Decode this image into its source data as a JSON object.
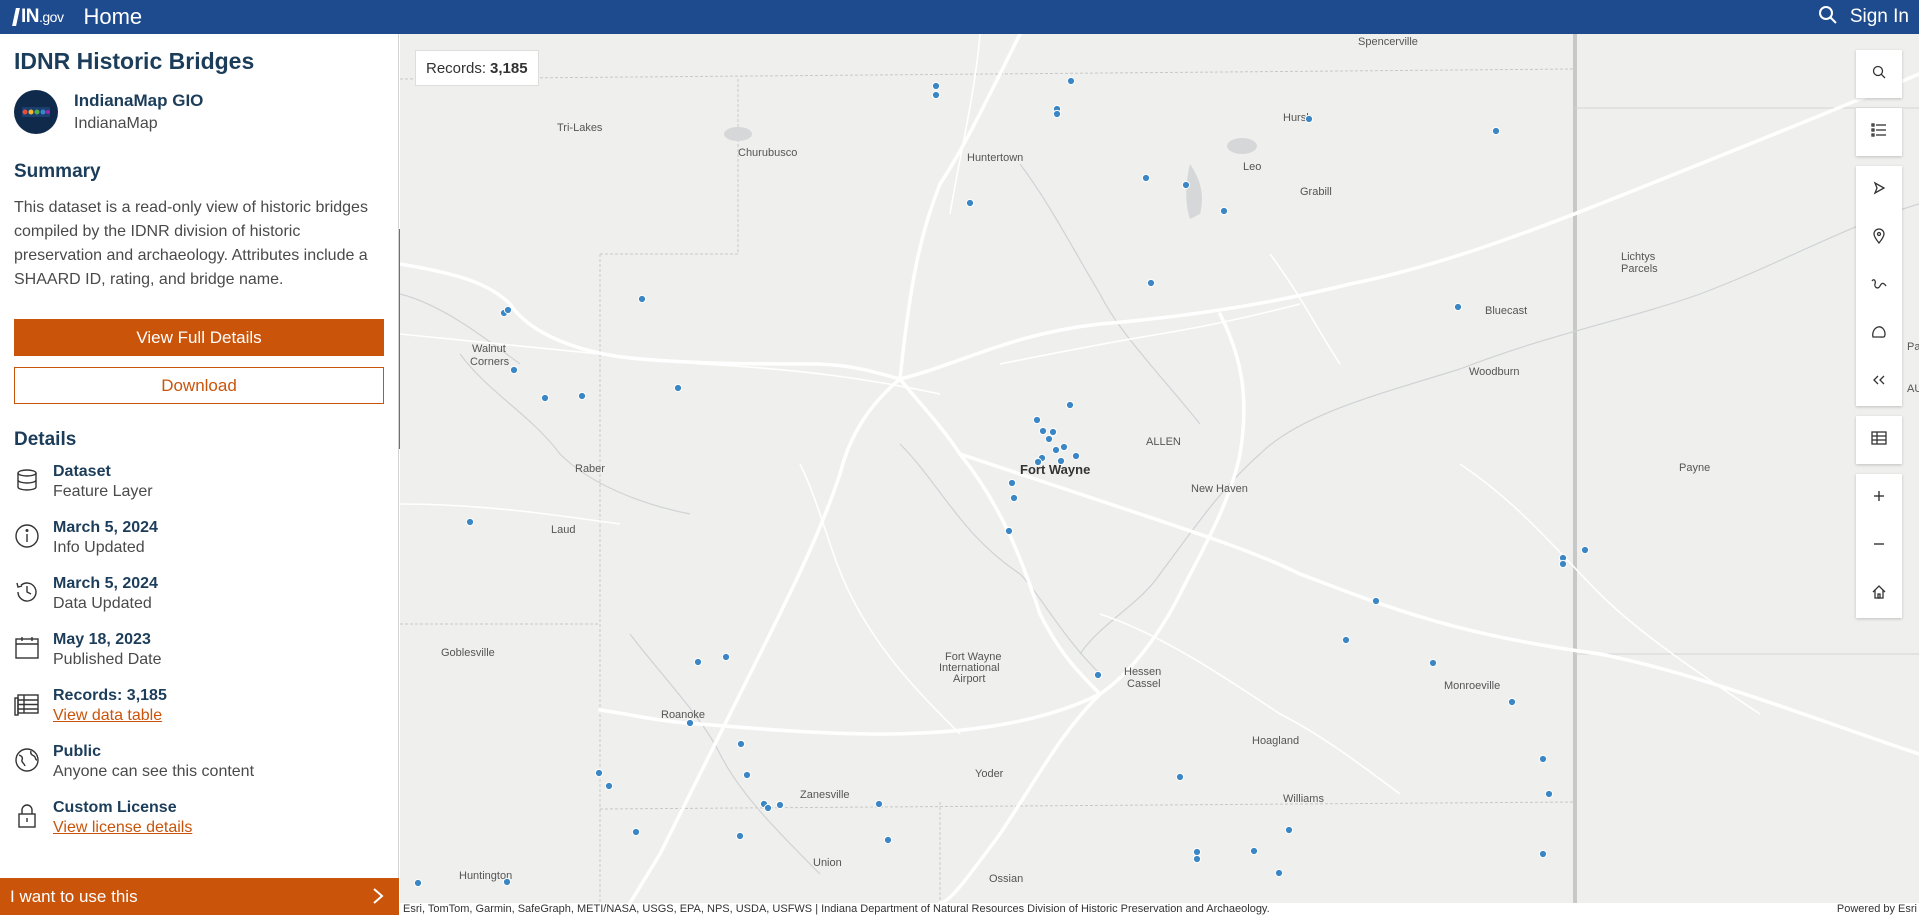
{
  "topbar": {
    "logo_text": "IN",
    "logo_suffix": ".gov",
    "home_label": "Home",
    "sign_in_label": "Sign In",
    "search_icon": "search-icon"
  },
  "item": {
    "title": "IDNR Historic Bridges",
    "owner_name": "IndianaMap GIO",
    "owner_org": "IndianaMap"
  },
  "summary": {
    "heading": "Summary",
    "text": "This dataset is a read-only view of historic bridges compiled by the IDNR division of historic preservation and archaeology. Attributes include a SHAARD ID, rating, and bridge name."
  },
  "buttons": {
    "view_full_details": "View Full Details",
    "download": "Download"
  },
  "details": {
    "heading": "Details",
    "rows": [
      {
        "icon": "database-icon",
        "main": "Dataset",
        "sub": "Feature Layer"
      },
      {
        "icon": "info-icon",
        "main": "March 5, 2024",
        "sub": "Info Updated"
      },
      {
        "icon": "history-icon",
        "main": "March 5, 2024",
        "sub": "Data Updated"
      },
      {
        "icon": "calendar-icon",
        "main": "May 18, 2023",
        "sub": "Published Date"
      },
      {
        "icon": "table-icon",
        "main": "Records: 3,185",
        "link": "View data table"
      },
      {
        "icon": "globe-icon",
        "main": "Public",
        "sub": "Anyone can see this content"
      },
      {
        "icon": "lock-icon",
        "main": "Custom License",
        "link": "View license details"
      }
    ]
  },
  "use_bar": {
    "label": "I want to use this"
  },
  "map": {
    "records_label": "Records:",
    "records_value": "3,185",
    "attribution": "Esri, TomTom, Garmin, SafeGraph, METI/NASA, USGS, EPA, NPS, USDA, USFWS | Indiana Department of Natural Resources Division of Historic Preservation and Archaeology.",
    "powered_by": "Powered by Esri",
    "point_color": "#3b86c4",
    "accent_color": "#c9540a",
    "labels": {
      "spencerville": "Spencerville",
      "tri_lakes": "Tri-Lakes",
      "churubusco": "Churubusco",
      "huntertown": "Huntertown",
      "hursh": "Hursh",
      "leo": "Leo",
      "grabill": "Grabill",
      "lichtys": "Lichtys",
      "parcels": "Parcels",
      "bluecast": "Bluecast",
      "woodburn": "Woodburn",
      "walnut": "Walnut",
      "corners": "Corners",
      "allen": "ALLEN",
      "fort_wayne": "Fort Wayne",
      "new_haven": "New Haven",
      "payne": "Payne",
      "raber": "Raber",
      "laud": "Laud",
      "goblesville": "Goblesville",
      "fw_airport_1": "Fort Wayne",
      "fw_airport_2": "International",
      "fw_airport_3": "Airport",
      "hessen": "Hessen",
      "cassel": "Cassel",
      "monroeville": "Monroeville",
      "roanoke": "Roanoke",
      "hoagland": "Hoagland",
      "yoder": "Yoder",
      "zanesville": "Zanesville",
      "williams": "Williams",
      "union": "Union",
      "ossian": "Ossian",
      "huntington": "Huntington",
      "pau": "Pau",
      "au": "AU"
    }
  },
  "side_tools": [
    "info-icon",
    "filter-icon",
    "download-cloud-icon",
    "star-icon",
    "share-icon",
    "translate-icon"
  ],
  "right_tools": [
    "search-icon",
    "legend-icon",
    "navigate-icon",
    "locate-icon",
    "measure-icon",
    "basemap-icon",
    "collapse-icon",
    "table-icon",
    "zoom-in-icon",
    "zoom-out-icon",
    "home-icon"
  ]
}
